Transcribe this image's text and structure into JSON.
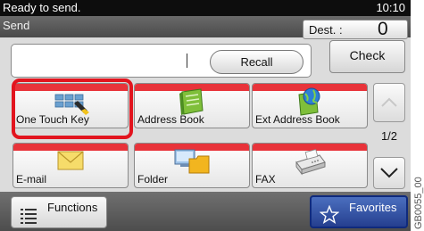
{
  "status": {
    "message": "Ready to send.",
    "clock": "10:10"
  },
  "header": {
    "title": "Send",
    "dest_label": "Dest. :",
    "dest_count": "0"
  },
  "destination": {
    "recall_label": "Recall",
    "check_label": "Check"
  },
  "tiles": [
    {
      "label": "One Touch Key",
      "icon": "one-touch-key-icon",
      "selected": true
    },
    {
      "label": "Address Book",
      "icon": "address-book-icon"
    },
    {
      "label": "Ext Address Book",
      "icon": "ext-address-book-icon"
    },
    {
      "label": "E-mail",
      "icon": "email-icon"
    },
    {
      "label": "Folder",
      "icon": "folder-icon"
    },
    {
      "label": "FAX",
      "icon": "fax-icon"
    }
  ],
  "pager": {
    "page": "1/2"
  },
  "footer": {
    "functions_label": "Functions",
    "favorites_label": "Favorites"
  },
  "side_code": "GB0055_00",
  "colors": {
    "accent_red": "#e8333a",
    "selection": "#e2141e",
    "favorites": "#253f8f"
  }
}
